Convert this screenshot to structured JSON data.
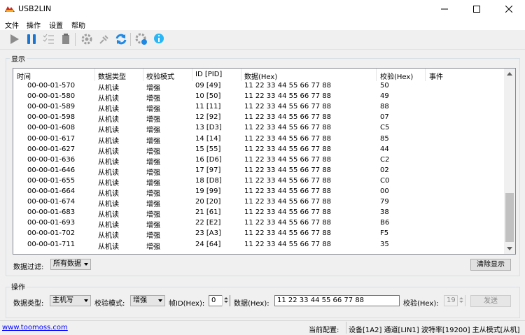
{
  "window": {
    "title": "USB2LIN"
  },
  "menu": [
    "文件",
    "操作",
    "设置",
    "帮助"
  ],
  "display_group": {
    "label": "显示"
  },
  "table": {
    "headers": [
      "时间",
      "数据类型",
      "校验模式",
      "ID [PID]",
      "数据(Hex)",
      "校验(Hex)",
      "事件"
    ],
    "rows": [
      [
        "00-00-01-570",
        "从机读",
        "增强",
        "09 [49]",
        "11 22 33 44 55 66 77 88",
        "50",
        ""
      ],
      [
        "00-00-01-580",
        "从机读",
        "增强",
        "10 [50]",
        "11 22 33 44 55 66 77 88",
        "49",
        ""
      ],
      [
        "00-00-01-589",
        "从机读",
        "增强",
        "11 [11]",
        "11 22 33 44 55 66 77 88",
        "88",
        ""
      ],
      [
        "00-00-01-598",
        "从机读",
        "增强",
        "12 [92]",
        "11 22 33 44 55 66 77 88",
        "07",
        ""
      ],
      [
        "00-00-01-608",
        "从机读",
        "增强",
        "13 [D3]",
        "11 22 33 44 55 66 77 88",
        "C5",
        ""
      ],
      [
        "00-00-01-617",
        "从机读",
        "增强",
        "14 [14]",
        "11 22 33 44 55 66 77 88",
        "85",
        ""
      ],
      [
        "00-00-01-627",
        "从机读",
        "增强",
        "15 [55]",
        "11 22 33 44 55 66 77 88",
        "44",
        ""
      ],
      [
        "00-00-01-636",
        "从机读",
        "增强",
        "16 [D6]",
        "11 22 33 44 55 66 77 88",
        "C2",
        ""
      ],
      [
        "00-00-01-646",
        "从机读",
        "增强",
        "17 [97]",
        "11 22 33 44 55 66 77 88",
        "02",
        ""
      ],
      [
        "00-00-01-655",
        "从机读",
        "增强",
        "18 [D8]",
        "11 22 33 44 55 66 77 88",
        "C0",
        ""
      ],
      [
        "00-00-01-664",
        "从机读",
        "增强",
        "19 [99]",
        "11 22 33 44 55 66 77 88",
        "00",
        ""
      ],
      [
        "00-00-01-674",
        "从机读",
        "增强",
        "20 [20]",
        "11 22 33 44 55 66 77 88",
        "79",
        ""
      ],
      [
        "00-00-01-683",
        "从机读",
        "增强",
        "21 [61]",
        "11 22 33 44 55 66 77 88",
        "38",
        ""
      ],
      [
        "00-00-01-693",
        "从机读",
        "增强",
        "22 [E2]",
        "11 22 33 44 55 66 77 88",
        "B6",
        ""
      ],
      [
        "00-00-01-702",
        "从机读",
        "增强",
        "23 [A3]",
        "11 22 33 44 55 66 77 88",
        "F5",
        ""
      ],
      [
        "00-00-01-711",
        "从机读",
        "增强",
        "24 [64]",
        "11 22 33 44 55 66 77 88",
        "35",
        ""
      ]
    ]
  },
  "filter": {
    "label": "数据过滤:",
    "value": "所有数据"
  },
  "clear_button": "清除显示",
  "operation_group": {
    "label": "操作"
  },
  "operation": {
    "data_type_label": "数据类型:",
    "data_type_value": "主机写",
    "check_mode_label": "校验模式:",
    "check_mode_value": "增强",
    "frame_id_label": "帧ID(Hex):",
    "frame_id_value": "0",
    "data_label": "数据(Hex):",
    "data_value": "11 22 33 44 55 66 77 88",
    "checksum_label": "校验(Hex):",
    "checksum_value": "19",
    "send_button": "发送"
  },
  "status": {
    "link": "www.toomoss.com",
    "config_label": "当前配置:",
    "config_value": "设备[1A2] 通道[LIN1] 波特率[19200] 主从模式[从机]"
  },
  "icons": [
    "play-icon",
    "pause-icon",
    "checklist-icon",
    "clipboard-icon",
    "gear-icon",
    "plug-icon",
    "refresh-icon",
    "settings-info-icon",
    "info-icon"
  ],
  "colors": {
    "accent": "#1e88e5",
    "link": "#0000ff"
  }
}
